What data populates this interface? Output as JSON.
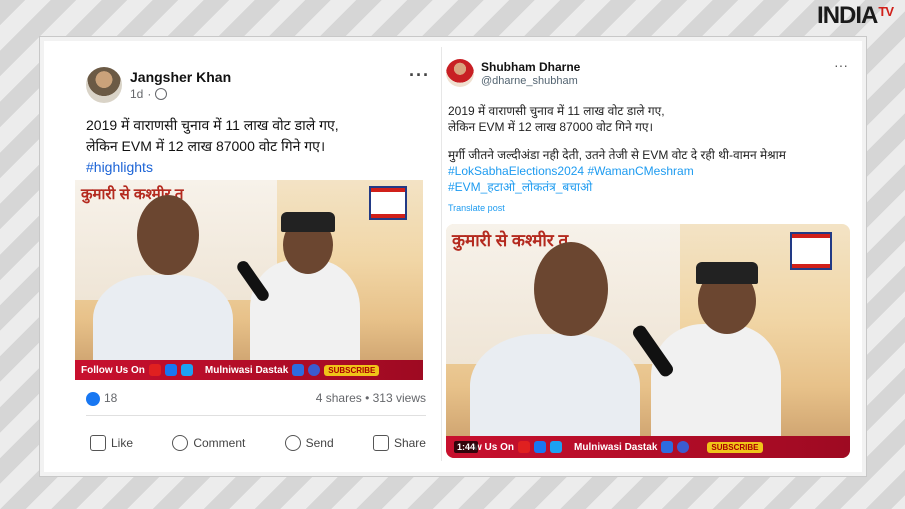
{
  "watermark": {
    "brand": "INDIA",
    "suffix": "TV"
  },
  "fb_post": {
    "author": "Jangsher Khan",
    "time": "1d",
    "line1": "2019 में वाराणसी चुनाव में 11 लाख वोट डाले गए,",
    "line2": "लेकिन EVM में 12 लाख 87000 वोट गिने गए।",
    "hashtag": "#highlights",
    "video": {
      "banner": "कुमारी से कश्मीर त",
      "follow_text": "Follow Us On",
      "channel": "Mulniwasi Dastak",
      "subscribe": "SUBSCRIBE"
    },
    "reactions_count": "18",
    "shares_views": "4 shares • 313 views",
    "actions": [
      "Like",
      "Comment",
      "Send",
      "Share"
    ]
  },
  "x_post": {
    "author": "Shubham Dharne",
    "handle": "@dharne_shubham",
    "line1": "2019 में वाराणसी चुनाव में 11 लाख वोट डाले गए,",
    "line2": "लेकिन EVM में 12 लाख 87000 वोट गिने गए।",
    "line3": "मुर्गी जीतने जल्दीअंडा नही देती, उतने तेजी से EVM  वोट दे रही थी-वामन मेश्राम",
    "hashtags1": "#LokSabhaElections2024 #WamanCMeshram",
    "hashtags2": "#EVM_हटाओ_लोकतंत्र_बचाओ",
    "translate": "Translate post",
    "video": {
      "banner": "कुमारी से कश्मीर त",
      "follow_text": "w Us On",
      "channel": "Mulniwasi Dastak",
      "subscribe": "SUBSCRIBE",
      "timecode": "1:44"
    }
  },
  "colors": {
    "fb_blue": "#1877f2",
    "link_blue": "#1b63d6",
    "x_blue": "#1d9bf0",
    "brand_red": "#d0201a"
  }
}
